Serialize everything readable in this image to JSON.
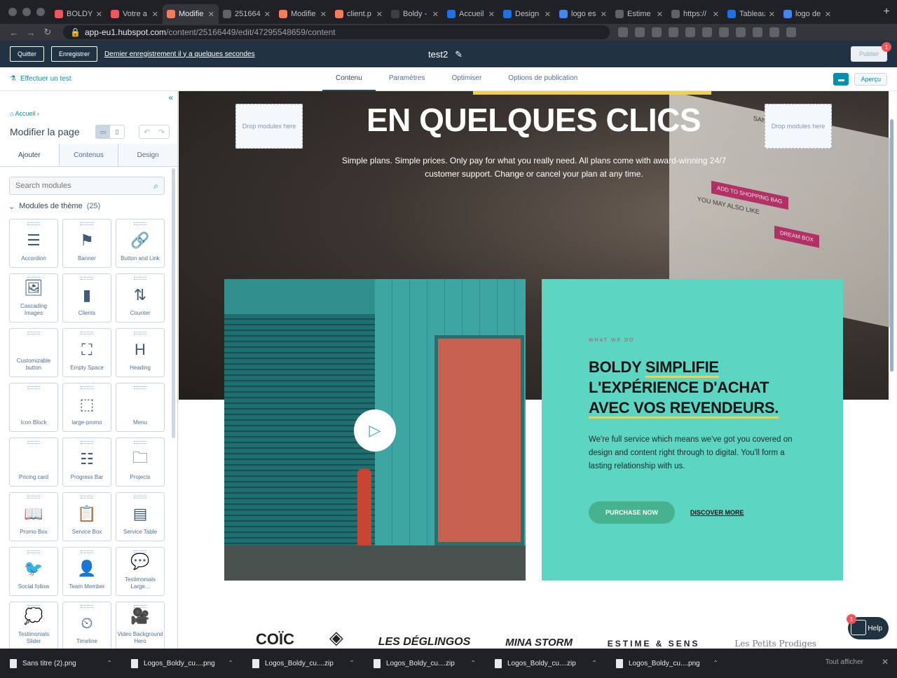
{
  "browser": {
    "tabs": [
      {
        "title": "BOLDY",
        "color": "#f2545b"
      },
      {
        "title": "Votre a",
        "color": "#f2545b"
      },
      {
        "title": "Modifie",
        "color": "#ff7a59",
        "active": true
      },
      {
        "title": "251664",
        "color": "#5f6368"
      },
      {
        "title": "Modifie",
        "color": "#ff7a59"
      },
      {
        "title": "client.p",
        "color": "#ff7a59"
      },
      {
        "title": "Boldy -",
        "color": "#3c4043"
      },
      {
        "title": "Accueil",
        "color": "#1a73e8"
      },
      {
        "title": "Design",
        "color": "#1a73e8"
      },
      {
        "title": "logo es",
        "color": "#4285f4"
      },
      {
        "title": "Estime",
        "color": "#5f6368"
      },
      {
        "title": "https://",
        "color": "#5f6368"
      },
      {
        "title": "Tableau",
        "color": "#1a73e8"
      },
      {
        "title": "logo de",
        "color": "#4285f4"
      }
    ],
    "url_host": "app-eu1.hubspot.com",
    "url_path": "/content/25166449/edit/47295548659/content"
  },
  "topbar": {
    "quit": "Quitter",
    "save": "Enregistrer",
    "saved_status": "Dernier enregistrement il y a quelques secondes",
    "page_title": "test2",
    "publish": "Publier",
    "notif_count": "1"
  },
  "subnav": {
    "test_link": "Effectuer un test",
    "tabs": [
      "Contenu",
      "Paramètres",
      "Optimiser",
      "Options de publication"
    ],
    "preview": "Aperçu"
  },
  "sidebar": {
    "breadcrumb": "Accueil",
    "heading": "Modifier la page",
    "tabs": [
      "Ajouter",
      "Contenus",
      "Design"
    ],
    "search_placeholder": "Search modules",
    "section_title": "Modules de thème",
    "section_count": "(25)",
    "modules": [
      {
        "label": "Accordion",
        "icon": "☰"
      },
      {
        "label": "Banner",
        "icon": "⚑"
      },
      {
        "label": "Button and Link",
        "icon": "🔗"
      },
      {
        "label": "Cascading Images",
        "icon": "🖼"
      },
      {
        "label": "Clients",
        "icon": "▮"
      },
      {
        "label": "Counter",
        "icon": "⇅"
      },
      {
        "label": "Customizable button",
        "icon": ""
      },
      {
        "label": "Empty Space",
        "icon": "⛶"
      },
      {
        "label": "Heading",
        "icon": "H"
      },
      {
        "label": "Icon Block",
        "icon": ""
      },
      {
        "label": "large-promo",
        "icon": "⬚"
      },
      {
        "label": "Menu",
        "icon": ""
      },
      {
        "label": "Pricing card",
        "icon": ""
      },
      {
        "label": "Progress Bar",
        "icon": "☷"
      },
      {
        "label": "Projects",
        "icon": "🗀"
      },
      {
        "label": "Promo Box",
        "icon": "📖"
      },
      {
        "label": "Service Box",
        "icon": "📋"
      },
      {
        "label": "Service Table",
        "icon": "▤"
      },
      {
        "label": "Social follow",
        "icon": "🐦"
      },
      {
        "label": "Team Member",
        "icon": "👤"
      },
      {
        "label": "Testimonials Large...",
        "icon": "💬"
      },
      {
        "label": "Testimonials Slider",
        "icon": "💭"
      },
      {
        "label": "Timeline",
        "icon": "⏲"
      },
      {
        "label": "Video Background Hero",
        "icon": "🎥"
      }
    ]
  },
  "canvas": {
    "drop_text": "Drop modules here",
    "hero_title": "EN QUELQUES CLICS",
    "hero_subtitle": "Simple plans. Simple prices. Only pay for what you really need. All plans come with award-winning 24/7 customer support. Change or cancel your plan at any time.",
    "tablet_text": {
      "sandals": "SANDALS",
      "shopping": "ADD TO SHOPPING BAG",
      "dream": "DREAM BOX",
      "also": "YOU MAY ALSO LIKE"
    },
    "card": {
      "eyebrow": "WHAT WE DO",
      "line1_a": "BOLDY ",
      "line1_b": "SIMPLIFIE",
      "line2": "L'EXPÉRIENCE D'ACHAT",
      "line3": "AVEC VOS REVENDEURS.",
      "body": "We're full service which means we've got you covered on design and content right through to digital. You'll form a lasting relationship with us.",
      "cta_primary": "PURCHASE NOW",
      "cta_secondary": "DISCOVER MORE"
    },
    "logos": [
      "COÏC",
      "◈",
      "LES DÉGLINGOS",
      "MINA STORM",
      "ESTIME & SENS",
      "Les Petits Prodiges"
    ],
    "help": "Help",
    "help_count": "1"
  },
  "downloads": {
    "files": [
      "Sans titre (2).png",
      "Logos_Boldy_cu....png",
      "Logos_Boldy_cu....zip",
      "Logos_Boldy_cu....zip",
      "Logos_Boldy_cu....zip",
      "Logos_Boldy_cu....png"
    ],
    "show_all": "Tout afficher"
  }
}
